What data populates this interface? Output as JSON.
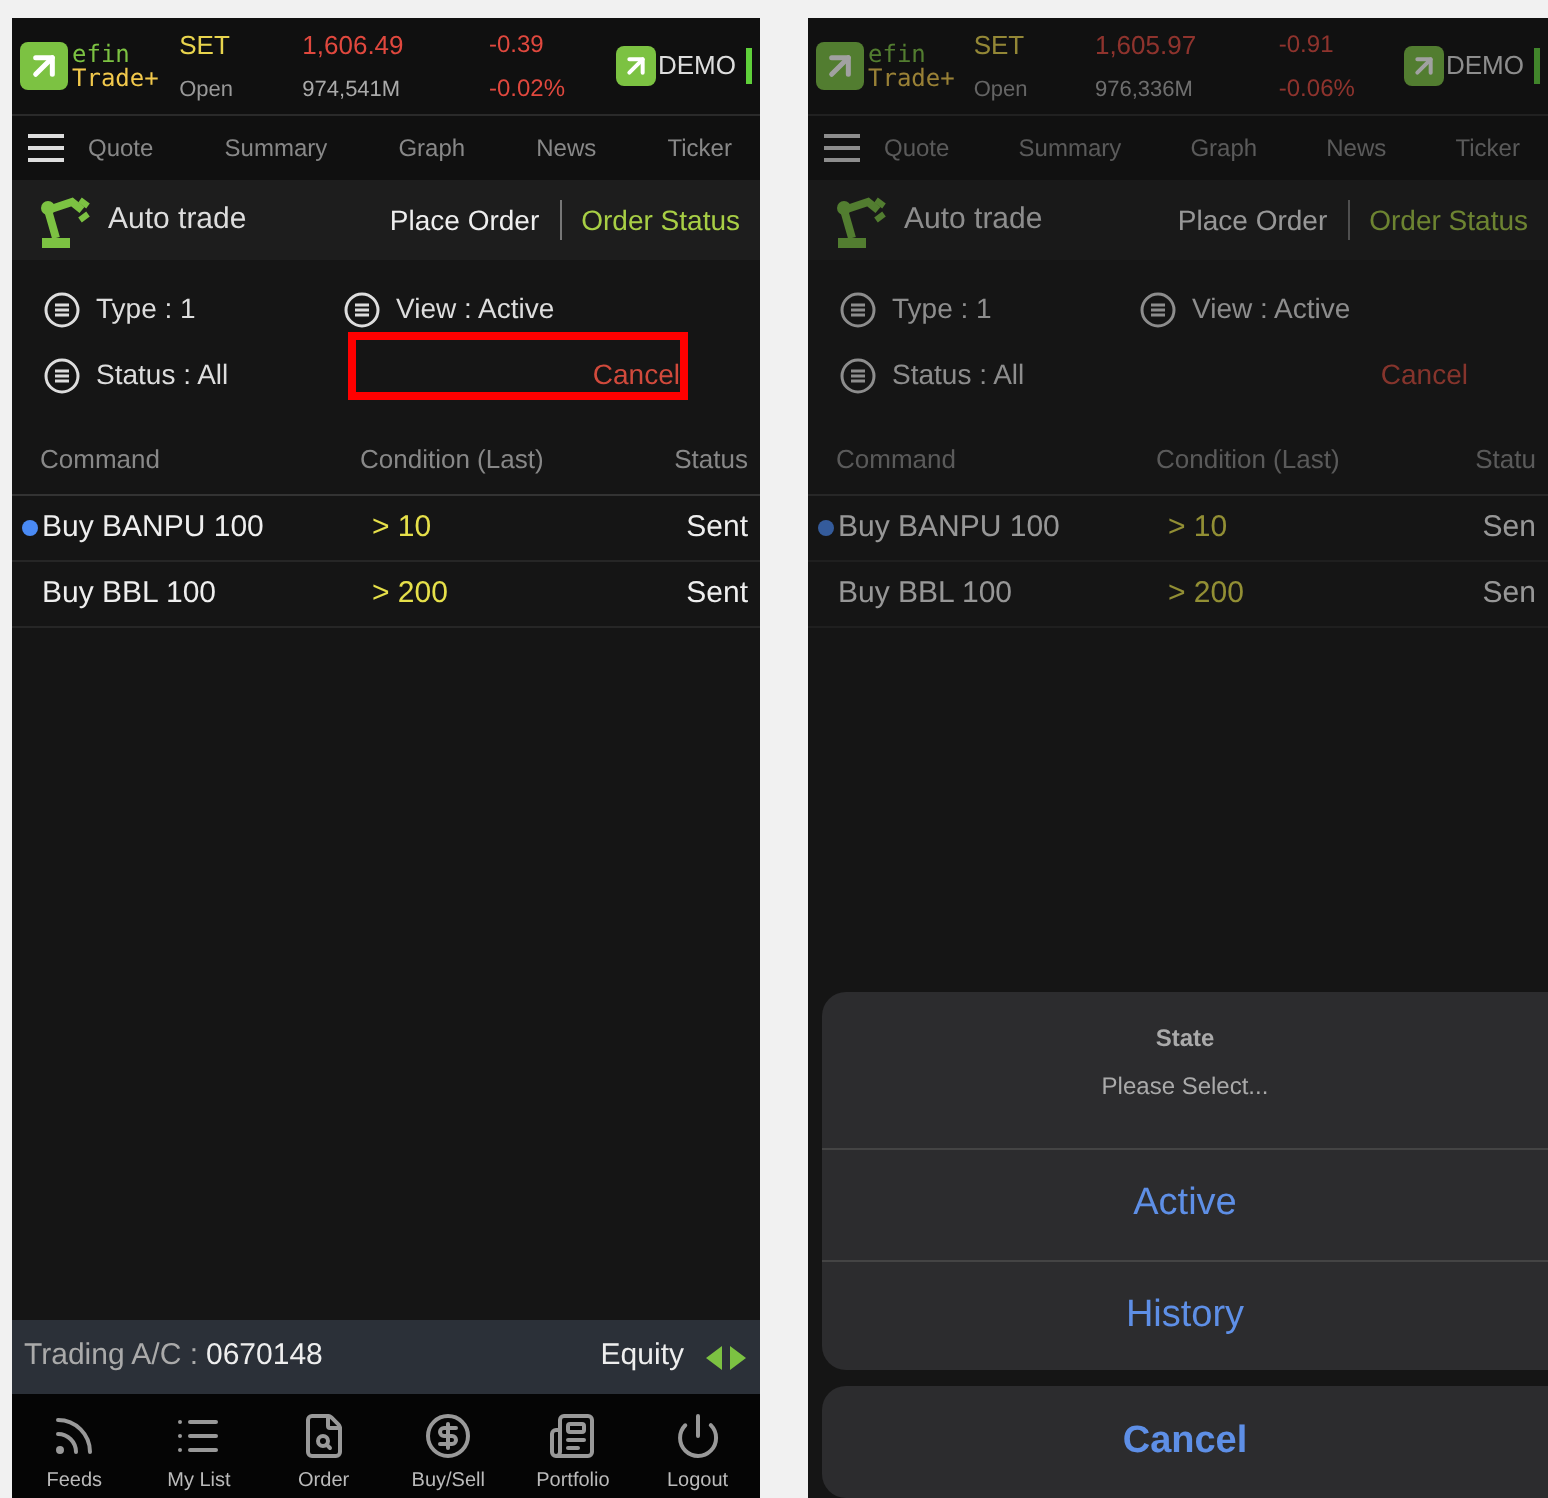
{
  "screens": [
    {
      "dimmed": false,
      "annotation_box": true,
      "header": {
        "logo_top": "efin",
        "logo_bottom": "Trade+",
        "index": "SET",
        "value": "1,606.49",
        "change": "-0.39",
        "session": "Open",
        "volume": "974,541M",
        "change_pct": "-0.02%",
        "badge": "DEMO"
      },
      "menu_tabs": [
        "Quote",
        "Summary",
        "Graph",
        "News",
        "Ticker"
      ],
      "section": {
        "title": "Auto trade",
        "tabs": [
          {
            "label": "Place Order",
            "selected": false
          },
          {
            "label": "Order Status",
            "selected": true
          }
        ]
      },
      "filters": {
        "type": "Type : 1",
        "view": "View : Active",
        "status": "Status : All",
        "cancel": "Cancel"
      },
      "columns": [
        "Command",
        "Condition (Last)",
        "Status"
      ],
      "rows": [
        {
          "command": "Buy BANPU 100",
          "condition": "> 10",
          "status": "Sent",
          "marked": true
        },
        {
          "command": "Buy BBL 100",
          "condition": "> 200",
          "status": "Sent",
          "marked": false
        }
      ],
      "account_bar": {
        "label": "Trading A/C :",
        "number": "0670148",
        "market": "Equity"
      },
      "nav": [
        {
          "label": "Feeds"
        },
        {
          "label": "My List"
        },
        {
          "label": "Order"
        },
        {
          "label": "Buy/Sell"
        },
        {
          "label": "Portfolio"
        },
        {
          "label": "Logout"
        }
      ]
    },
    {
      "dimmed": true,
      "header": {
        "logo_top": "efin",
        "logo_bottom": "Trade+",
        "index": "SET",
        "value": "1,605.97",
        "change": "-0.91",
        "session": "Open",
        "volume": "976,336M",
        "change_pct": "-0.06%",
        "badge": "DEMO"
      },
      "menu_tabs": [
        "Quote",
        "Summary",
        "Graph",
        "News",
        "Ticker"
      ],
      "section": {
        "title": "Auto trade",
        "tabs": [
          {
            "label": "Place Order",
            "selected": false
          },
          {
            "label": "Order Status",
            "selected": true
          }
        ]
      },
      "filters": {
        "type": "Type : 1",
        "view": "View : Active",
        "status": "Status : All",
        "cancel": "Cancel"
      },
      "columns": [
        "Command",
        "Condition (Last)",
        "Statu"
      ],
      "rows": [
        {
          "command": "Buy BANPU 100",
          "condition": "> 10",
          "status": "Sen",
          "marked": true
        },
        {
          "command": "Buy BBL 100",
          "condition": "> 200",
          "status": "Sen",
          "marked": false
        }
      ],
      "action_sheet": {
        "title": "State",
        "message": "Please Select...",
        "options": [
          "Active",
          "History"
        ],
        "cancel": "Cancel"
      }
    }
  ]
}
